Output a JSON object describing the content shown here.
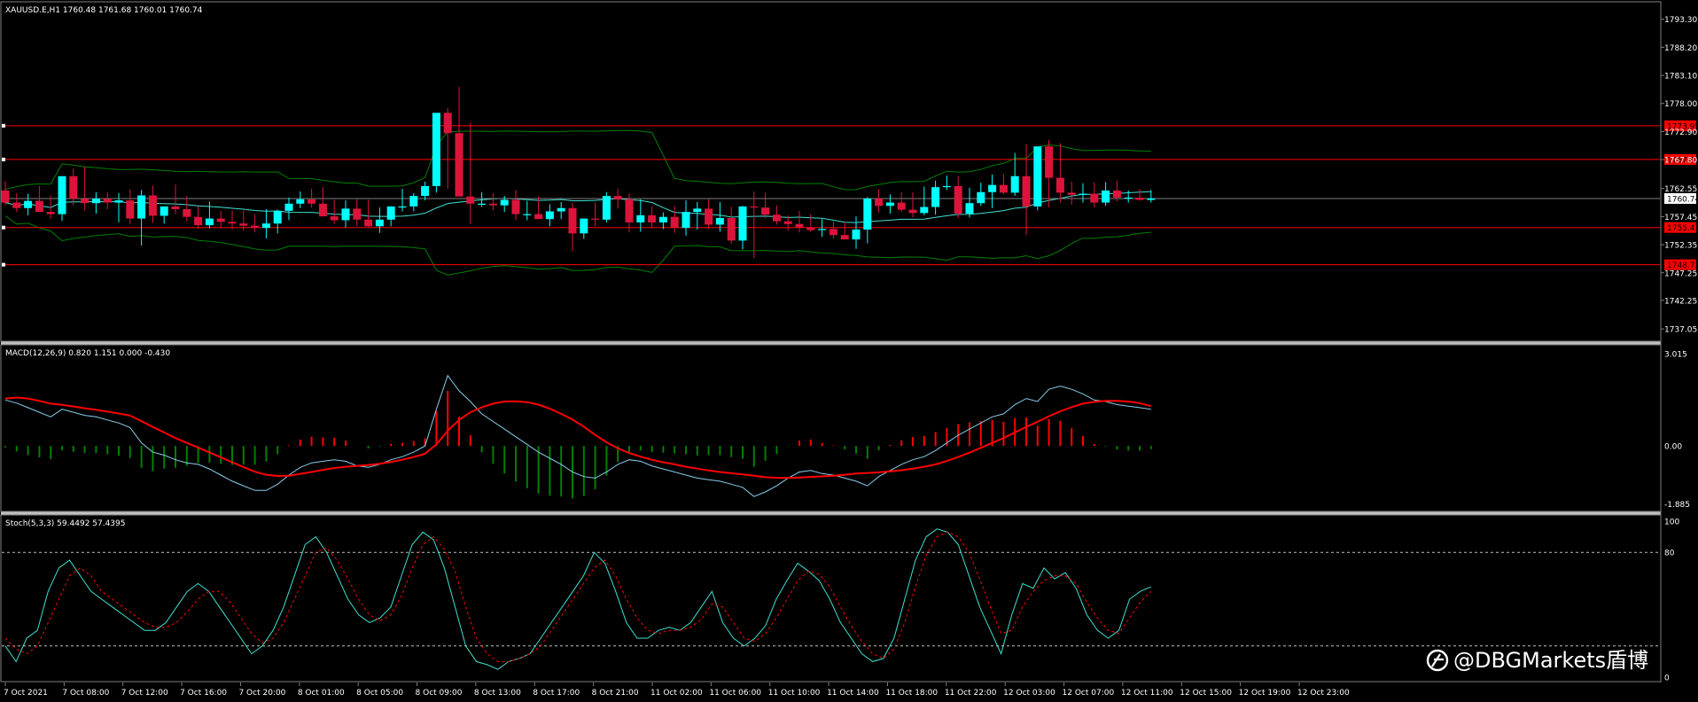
{
  "chart_data": [
    {
      "type": "candlestick",
      "symbol_header": "XAUUSD.E,H1  1760.48 1761.68 1760.01 1760.74",
      "price_ticks": [
        "1793.30",
        "1788.20",
        "1783.10",
        "1778.00",
        "1772.90",
        "1767.80",
        "1762.55",
        "1757.45",
        "1752.35",
        "1747.25",
        "1742.25",
        "1737.05"
      ],
      "ylim": [
        1735.3,
        1795.5
      ],
      "current_price": "1760.74",
      "levels": [
        {
          "value": 1773.95,
          "label": "1773.95"
        },
        {
          "value": 1767.83,
          "label": "1767.83"
        },
        {
          "value": 1755.47,
          "label": "1755.47"
        },
        {
          "value": 1748.72,
          "label": "1748.72"
        }
      ],
      "open": [
        1762.2,
        1760.0,
        1759.0,
        1760.3,
        1758.3,
        1757.9,
        1764.8,
        1760.7,
        1759.9,
        1760.7,
        1760.0,
        1760.4,
        1757.1,
        1761.3,
        1757.6,
        1759.3,
        1758.8,
        1757.4,
        1755.9,
        1757.1,
        1756.5,
        1756.2,
        1755.8,
        1755.4,
        1756.2,
        1758.5,
        1759.8,
        1760.6,
        1759.8,
        1757.5,
        1756.8,
        1758.9,
        1756.9,
        1755.7,
        1756.9,
        1759.3,
        1759.3,
        1761.2,
        1763.0,
        1776.3,
        1772.6,
        1761.1,
        1759.8,
        1759.8,
        1759.5,
        1760.5,
        1757.9,
        1757.9,
        1757.0,
        1758.4,
        1759.0,
        1754.4,
        1757.1,
        1756.9,
        1761.2,
        1760.6,
        1756.4,
        1757.7,
        1756.4,
        1757.4,
        1755.4,
        1758.3,
        1758.9,
        1756.0,
        1757.2,
        1753.1,
        1759.3,
        1759.1,
        1757.8,
        1756.6,
        1756.1,
        1755.5,
        1755.0,
        1755.2,
        1754.1,
        1753.3,
        1755.1,
        1760.7,
        1759.4,
        1760.0,
        1758.7,
        1758.1,
        1759.2,
        1762.8,
        1763.0,
        1758.0,
        1759.9,
        1761.9,
        1763.2,
        1761.8,
        1764.8,
        1759.3,
        1770.2,
        1764.5,
        1761.8,
        1761.4,
        1761.6,
        1760.0,
        1762.2,
        1760.9,
        1760.9,
        1760.48
      ],
      "high": [
        1763.9,
        1761.7,
        1761.6,
        1763.0,
        1761.3,
        1761.8,
        1766.2,
        1766.5,
        1761.9,
        1761.9,
        1761.7,
        1762.4,
        1762.3,
        1763.1,
        1759.3,
        1763.3,
        1761.2,
        1759.3,
        1760.2,
        1758.5,
        1758.5,
        1758.6,
        1757.9,
        1758.8,
        1758.7,
        1760.9,
        1762.0,
        1762.5,
        1762.8,
        1760.5,
        1760.4,
        1760.6,
        1760.5,
        1759.1,
        1759.3,
        1762.5,
        1761.7,
        1763.8,
        1765.4,
        1777.2,
        1781.0,
        1774.5,
        1761.9,
        1761.7,
        1761.2,
        1762.3,
        1760.3,
        1761.1,
        1759.7,
        1760.1,
        1759.9,
        1756.9,
        1760.0,
        1761.9,
        1762.5,
        1761.7,
        1760.6,
        1759.3,
        1758.2,
        1759.4,
        1760.4,
        1760.1,
        1760.6,
        1760.1,
        1759.2,
        1759.4,
        1762.0,
        1761.8,
        1759.5,
        1757.7,
        1758.5,
        1757.9,
        1757.0,
        1756.6,
        1756.6,
        1757.5,
        1761.0,
        1762.4,
        1761.5,
        1761.9,
        1761.9,
        1762.9,
        1764.0,
        1764.9,
        1764.8,
        1762.7,
        1763.6,
        1765.1,
        1765.2,
        1769.0,
        1770.6,
        1768.0,
        1771.4,
        1770.8,
        1763.8,
        1763.5,
        1763.7,
        1763.7,
        1764.0,
        1762.2,
        1762.5,
        1762.3
      ],
      "low": [
        1759.5,
        1758.3,
        1757.7,
        1758.3,
        1757.1,
        1756.7,
        1759.5,
        1758.6,
        1758.0,
        1758.8,
        1756.4,
        1756.1,
        1752.2,
        1756.3,
        1756.2,
        1757.9,
        1756.6,
        1755.2,
        1755.3,
        1755.5,
        1755.1,
        1754.9,
        1754.6,
        1753.5,
        1754.4,
        1756.8,
        1759.0,
        1759.1,
        1757.5,
        1756.1,
        1755.5,
        1755.7,
        1755.5,
        1754.5,
        1755.7,
        1758.4,
        1758.4,
        1760.4,
        1761.8,
        1762.5,
        1769.5,
        1756.1,
        1759.2,
        1758.6,
        1758.3,
        1756.8,
        1756.8,
        1757.2,
        1755.7,
        1757.0,
        1751.2,
        1753.4,
        1755.7,
        1756.4,
        1758.9,
        1754.6,
        1754.7,
        1755.4,
        1755.2,
        1754.5,
        1754.0,
        1755.1,
        1755.2,
        1754.7,
        1752.5,
        1751.5,
        1749.9,
        1757.2,
        1756.0,
        1754.9,
        1754.6,
        1754.7,
        1753.8,
        1753.4,
        1753.3,
        1751.6,
        1752.6,
        1758.2,
        1758.0,
        1758.3,
        1757.3,
        1757.7,
        1757.8,
        1762.3,
        1757.2,
        1757.3,
        1759.4,
        1759.0,
        1761.5,
        1761.2,
        1754.1,
        1758.6,
        1759.1,
        1760.0,
        1759.6,
        1760.0,
        1759.1,
        1759.4,
        1760.2,
        1760.0,
        1760.4,
        1760.0
      ],
      "close": [
        1760.0,
        1759.0,
        1760.3,
        1758.3,
        1757.9,
        1764.8,
        1760.7,
        1759.9,
        1760.7,
        1760.0,
        1760.4,
        1757.1,
        1761.3,
        1757.6,
        1759.3,
        1758.8,
        1757.4,
        1755.9,
        1757.1,
        1756.5,
        1756.2,
        1755.8,
        1755.4,
        1756.2,
        1758.5,
        1759.8,
        1760.6,
        1759.8,
        1757.5,
        1756.8,
        1758.9,
        1756.9,
        1755.7,
        1756.9,
        1759.3,
        1759.3,
        1761.2,
        1763.0,
        1776.3,
        1772.6,
        1761.1,
        1759.8,
        1759.8,
        1759.5,
        1760.5,
        1757.9,
        1757.9,
        1757.0,
        1758.4,
        1759.0,
        1754.4,
        1757.1,
        1756.9,
        1761.2,
        1760.6,
        1756.4,
        1757.7,
        1756.4,
        1757.4,
        1755.4,
        1758.3,
        1758.9,
        1756.0,
        1757.2,
        1753.1,
        1759.3,
        1759.1,
        1757.8,
        1756.6,
        1756.1,
        1755.5,
        1755.0,
        1755.2,
        1754.1,
        1753.3,
        1755.1,
        1760.7,
        1759.4,
        1760.0,
        1758.7,
        1758.1,
        1759.2,
        1762.8,
        1763.0,
        1758.0,
        1759.9,
        1761.9,
        1763.2,
        1761.8,
        1764.8,
        1759.3,
        1770.2,
        1764.5,
        1761.8,
        1761.4,
        1761.6,
        1760.0,
        1762.2,
        1760.9,
        1760.9,
        1760.48,
        1760.74
      ]
    },
    {
      "type": "macd",
      "header": "MACD(12,26,9) 0.820 1.151 0.000 -0.430",
      "ticks": [
        "3.015",
        "0.00",
        "-1.885"
      ],
      "ylim": [
        -2.05,
        3.1
      ],
      "macd": [
        1.5,
        1.4,
        1.25,
        1.1,
        0.95,
        1.2,
        1.1,
        1.0,
        0.95,
        0.85,
        0.75,
        0.6,
        0.1,
        -0.2,
        -0.3,
        -0.45,
        -0.55,
        -0.6,
        -0.75,
        -0.95,
        -1.15,
        -1.3,
        -1.45,
        -1.45,
        -1.25,
        -0.95,
        -0.7,
        -0.55,
        -0.5,
        -0.45,
        -0.5,
        -0.65,
        -0.7,
        -0.6,
        -0.45,
        -0.35,
        -0.2,
        0.0,
        1.2,
        2.3,
        1.8,
        1.45,
        1.05,
        0.8,
        0.55,
        0.3,
        0.05,
        -0.2,
        -0.4,
        -0.6,
        -0.85,
        -1.0,
        -1.05,
        -0.85,
        -0.6,
        -0.45,
        -0.5,
        -0.65,
        -0.75,
        -0.85,
        -0.95,
        -1.05,
        -1.1,
        -1.15,
        -1.25,
        -1.35,
        -1.65,
        -1.5,
        -1.3,
        -1.05,
        -0.85,
        -0.8,
        -0.9,
        -0.95,
        -1.05,
        -1.15,
        -1.3,
        -1.0,
        -0.8,
        -0.6,
        -0.45,
        -0.35,
        -0.15,
        0.1,
        0.35,
        0.55,
        0.75,
        0.95,
        1.05,
        1.35,
        1.55,
        1.45,
        1.85,
        1.95,
        1.85,
        1.7,
        1.5,
        1.45,
        1.35,
        1.3,
        1.25,
        1.2
      ],
      "signal": [
        1.55,
        1.58,
        1.55,
        1.47,
        1.38,
        1.34,
        1.29,
        1.23,
        1.18,
        1.12,
        1.06,
        0.99,
        0.81,
        0.62,
        0.44,
        0.26,
        0.1,
        -0.05,
        -0.21,
        -0.37,
        -0.53,
        -0.69,
        -0.84,
        -0.94,
        -0.98,
        -0.97,
        -0.91,
        -0.85,
        -0.78,
        -0.72,
        -0.68,
        -0.65,
        -0.62,
        -0.58,
        -0.52,
        -0.45,
        -0.36,
        -0.25,
        0.05,
        0.5,
        0.85,
        1.1,
        1.26,
        1.38,
        1.45,
        1.46,
        1.43,
        1.35,
        1.22,
        1.05,
        0.86,
        0.63,
        0.36,
        0.12,
        -0.08,
        -0.23,
        -0.35,
        -0.45,
        -0.53,
        -0.6,
        -0.68,
        -0.74,
        -0.8,
        -0.85,
        -0.89,
        -0.93,
        -0.97,
        -1.02,
        -1.04,
        -1.04,
        -1.03,
        -1.01,
        -0.99,
        -0.97,
        -0.94,
        -0.9,
        -0.88,
        -0.86,
        -0.83,
        -0.79,
        -0.74,
        -0.68,
        -0.6,
        -0.49,
        -0.36,
        -0.22,
        -0.06,
        0.1,
        0.26,
        0.44,
        0.62,
        0.79,
        0.97,
        1.13,
        1.27,
        1.38,
        1.44,
        1.47,
        1.47,
        1.45,
        1.4,
        1.3
      ],
      "histogram": [
        -0.05,
        -0.18,
        -0.3,
        -0.37,
        -0.43,
        -0.14,
        -0.19,
        -0.23,
        -0.23,
        -0.27,
        -0.31,
        -0.39,
        -0.71,
        -0.82,
        -0.74,
        -0.71,
        -0.65,
        -0.55,
        -0.54,
        -0.58,
        -0.62,
        -0.61,
        -0.61,
        -0.51,
        -0.27,
        0.02,
        0.21,
        0.3,
        0.28,
        0.27,
        0.18,
        0.0,
        -0.08,
        -0.02,
        0.07,
        0.1,
        0.16,
        0.25,
        1.15,
        1.8,
        0.95,
        0.35,
        -0.21,
        -0.58,
        -0.9,
        -1.16,
        -1.38,
        -1.55,
        -1.62,
        -1.65,
        -1.71,
        -1.63,
        -1.41,
        -0.97,
        -0.52,
        -0.22,
        -0.15,
        -0.2,
        -0.22,
        -0.25,
        -0.27,
        -0.31,
        -0.3,
        -0.3,
        -0.36,
        -0.42,
        -0.68,
        -0.48,
        -0.26,
        -0.01,
        0.18,
        0.21,
        0.09,
        0.02,
        -0.11,
        -0.25,
        -0.42,
        -0.14,
        0.03,
        0.19,
        0.29,
        0.33,
        0.45,
        0.59,
        0.71,
        0.77,
        0.81,
        0.85,
        0.79,
        0.91,
        0.93,
        0.66,
        0.88,
        0.82,
        0.58,
        0.32,
        0.06,
        -0.02,
        -0.12,
        -0.15,
        -0.15,
        -0.1
      ]
    },
    {
      "type": "stochastic",
      "header": "Stoch(5,3,3) 59.4492 57.4395",
      "ticks": [
        "100",
        "80",
        "0"
      ],
      "levels": [
        20,
        80
      ],
      "ylim": [
        0,
        100
      ],
      "main": [
        20,
        10,
        25,
        30,
        55,
        70,
        75,
        65,
        55,
        50,
        45,
        40,
        35,
        30,
        30,
        35,
        45,
        55,
        60,
        55,
        45,
        35,
        25,
        15,
        20,
        30,
        45,
        65,
        85,
        90,
        80,
        65,
        50,
        40,
        35,
        38,
        45,
        65,
        85,
        93,
        88,
        70,
        45,
        20,
        10,
        8,
        5,
        10,
        12,
        15,
        25,
        35,
        45,
        55,
        65,
        80,
        73,
        55,
        35,
        25,
        25,
        30,
        32,
        30,
        35,
        45,
        55,
        35,
        25,
        20,
        25,
        33,
        50,
        62,
        73,
        68,
        62,
        50,
        35,
        25,
        15,
        10,
        12,
        25,
        50,
        75,
        90,
        95,
        93,
        85,
        65,
        45,
        30,
        15,
        40,
        60,
        57,
        70,
        63,
        67,
        57,
        40,
        30,
        25,
        30,
        50,
        55,
        58
      ],
      "signal": [
        25,
        18,
        15,
        20,
        35,
        50,
        65,
        70,
        65,
        55,
        50,
        45,
        40,
        35,
        32,
        32,
        35,
        42,
        50,
        55,
        55,
        48,
        38,
        28,
        22,
        25,
        35,
        50,
        65,
        80,
        83,
        75,
        63,
        50,
        40,
        36,
        40,
        52,
        70,
        85,
        90,
        82,
        68,
        45,
        25,
        15,
        10,
        10,
        12,
        15,
        20,
        30,
        40,
        50,
        60,
        70,
        75,
        65,
        50,
        38,
        30,
        28,
        30,
        30,
        32,
        37,
        47,
        45,
        35,
        25,
        23,
        28,
        38,
        50,
        62,
        68,
        66,
        58,
        45,
        33,
        23,
        15,
        12,
        18,
        35,
        58,
        78,
        90,
        93,
        90,
        80,
        63,
        45,
        28,
        30,
        45,
        55,
        62,
        65,
        65,
        60,
        48,
        38,
        30,
        28,
        38,
        48,
        55
      ]
    }
  ],
  "xaxis": {
    "labels": [
      "7 Oct 2021",
      "7 Oct 08:00",
      "7 Oct 12:00",
      "7 Oct 16:00",
      "7 Oct 20:00",
      "8 Oct 01:00",
      "8 Oct 05:00",
      "8 Oct 09:00",
      "8 Oct 13:00",
      "8 Oct 17:00",
      "8 Oct 21:00",
      "11 Oct 02:00",
      "11 Oct 06:00",
      "11 Oct 10:00",
      "11 Oct 14:00",
      "11 Oct 18:00",
      "11 Oct 22:00",
      "12 Oct 03:00",
      "12 Oct 07:00",
      "12 Oct 11:00",
      "12 Oct 15:00",
      "12 Oct 19:00",
      "12 Oct 23:00"
    ]
  },
  "watermark": "@DBGMarkets盾博",
  "colors": {
    "bull": "#00ffff",
    "bear": "#dc143c",
    "level": "#ff0000",
    "band": "#008000",
    "ma": "#40e0d0",
    "macd_line": "#87ceeb",
    "signal_line": "#ff0000",
    "hist_pos": "#ff0000",
    "hist_neg": "#008000"
  }
}
